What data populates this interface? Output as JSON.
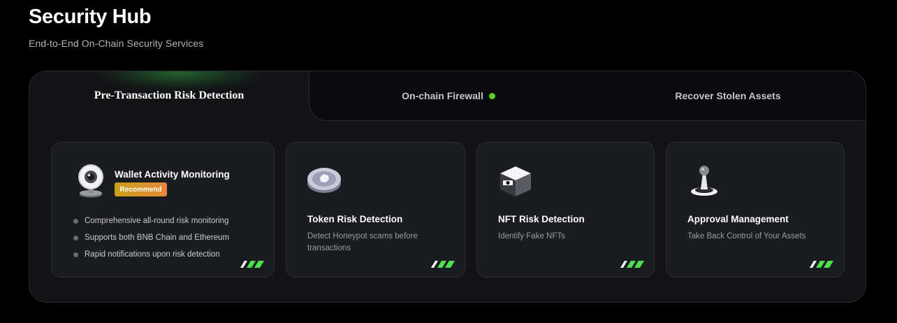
{
  "header": {
    "title": "Security Hub",
    "subtitle": "End-to-End On-Chain Security Services"
  },
  "tabs": [
    {
      "label": "Pre-Transaction Risk Detection",
      "active": true
    },
    {
      "label": "On-chain Firewall",
      "status": "active-dot"
    },
    {
      "label": "Recover Stolen Assets"
    }
  ],
  "cards": [
    {
      "icon": "webcam-icon",
      "title": "Wallet Activity Monitoring",
      "badge": "Recommend",
      "bullets": [
        "Comprehensive all-round risk monitoring",
        "Supports both BNB Chain and Ethereum",
        "Rapid notifications upon risk detection"
      ]
    },
    {
      "icon": "token-coin-icon",
      "title": "Token Risk Detection",
      "description": "Detect Honeypot scams before transactions"
    },
    {
      "icon": "nft-box-icon",
      "title": "NFT Risk Detection",
      "description": "Identify Fake NFTs"
    },
    {
      "icon": "joystick-icon",
      "title": "Approval Management",
      "description": "Take Back Control of Your Assets"
    }
  ],
  "colors": {
    "accent_green": "#58d323",
    "badge_start": "#c9a11b",
    "badge_end": "#e8883a",
    "card_bg": "#1b1c20",
    "panel_bg": "#131316"
  }
}
